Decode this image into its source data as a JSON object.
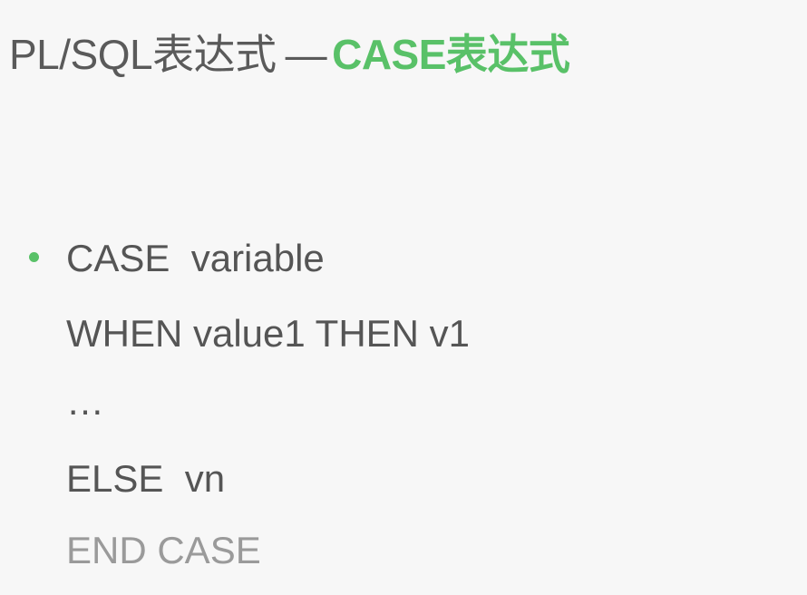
{
  "title": {
    "plain": "PL/SQL表达式",
    "separator": "—",
    "accent": "CASE表达式"
  },
  "code": {
    "line1": "CASE  variable",
    "line2": "WHEN value1 THEN v1",
    "line3": "…",
    "line4": "ELSE  vn",
    "line5": "END CASE"
  },
  "colors": {
    "background": "#f7f7f7",
    "text": "#555555",
    "accent": "#59c168",
    "muted": "#9a9a9a"
  }
}
